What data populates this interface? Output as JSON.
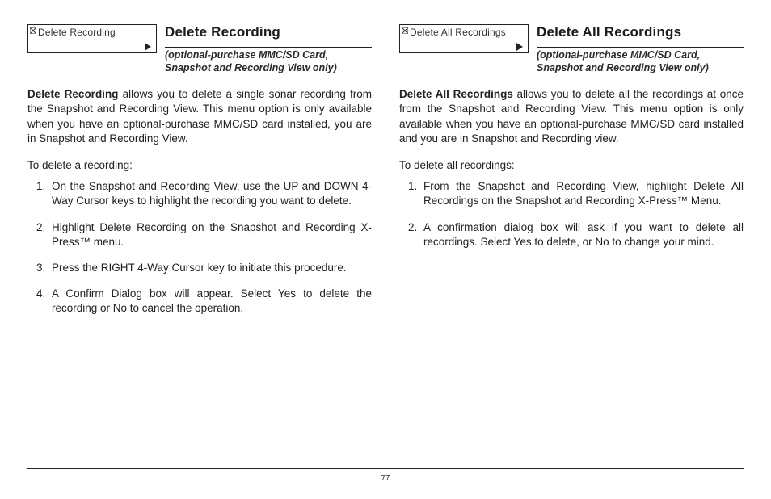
{
  "left": {
    "menu_icon": "close-icon",
    "menu_label": "Delete Recording",
    "title": "Delete Recording",
    "subtitle1": "(optional-purchase MMC/SD Card,",
    "subtitle2": "Snapshot and Recording View only)",
    "desc_lead": "Delete Recording",
    "desc_rest": " allows you to delete a single sonar recording from the Snapshot and Recording View. This menu option is only available when you have an optional-purchase MMC/SD card installed, you are in Snapshot and Recording View.",
    "howto": "To delete a recording:",
    "steps": [
      "On the Snapshot and Recording View, use the UP and DOWN 4-Way Cursor keys to highlight the recording you want to delete.",
      "Highlight Delete Recording on the Snapshot and Recording X-Press™ menu.",
      "Press the RIGHT 4-Way Cursor key to initiate this procedure.",
      "A Confirm Dialog box will appear. Select Yes to delete the recording or No to cancel the operation."
    ]
  },
  "right": {
    "menu_icon": "close-icon",
    "menu_label": "Delete All Recordings",
    "title": "Delete All Recordings",
    "subtitle1": "(optional-purchase MMC/SD Card,",
    "subtitle2": "Snapshot and Recording View only)",
    "desc_lead": "Delete All Recordings",
    "desc_rest": " allows you to delete all the recordings at once from the Snapshot and Recording View. This menu option is only available when you have an optional-purchase MMC/SD card installed and you are in Snapshot and Recording view.",
    "howto": "To delete all recordings:",
    "steps": [
      "From the Snapshot and Recording View, highlight Delete All Recordings on the Snapshot and Recording X-Press™ Menu.",
      "A confirmation dialog box will ask if you want to delete all recordings. Select Yes to delete, or No to change your mind."
    ]
  },
  "page_number": "77"
}
